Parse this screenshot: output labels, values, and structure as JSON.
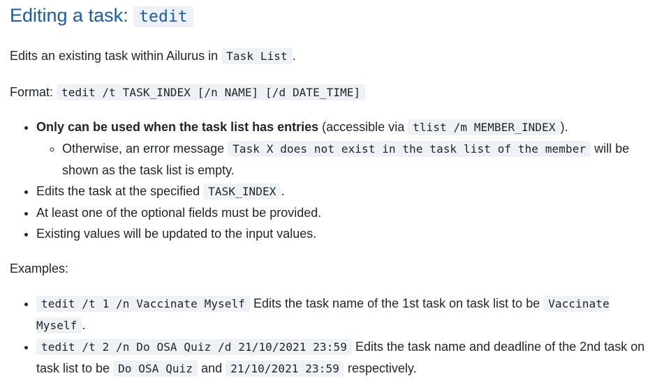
{
  "heading": {
    "text": "Editing a task:",
    "command": "tedit"
  },
  "intro": {
    "before": "Edits an existing task within Ailurus in",
    "code": "Task List",
    "after": "."
  },
  "format": {
    "label": "Format:",
    "code": "tedit /t TASK_INDEX [/n NAME] [/d DATE_TIME]"
  },
  "notes": {
    "item1": {
      "bold": "Only can be used when the task list has entries",
      "before": "(accessible via",
      "code": "tlist /m MEMBER_INDEX",
      "after": ").",
      "sub": {
        "before": "Otherwise, an error message",
        "code": "Task X does not exist in the task list of the member",
        "after": "will be shown as the task list is empty."
      }
    },
    "item2": {
      "before": "Edits the task at the specified",
      "code": "TASK_INDEX",
      "after": "."
    },
    "item3": "At least one of the optional fields must be provided.",
    "item4": "Existing values will be updated to the input values."
  },
  "examples": {
    "label": "Examples:",
    "ex1": {
      "code": "tedit /t 1 /n Vaccinate Myself",
      "text": "Edits the task name of the 1st task on task list to be",
      "code2": "Vaccinate Myself",
      "after": "."
    },
    "ex2": {
      "code": "tedit /t 2 /n Do OSA Quiz /d 21/10/2021 23:59",
      "text": "Edits the task name and deadline of the 2nd task on task list to be",
      "code2": "Do OSA Quiz",
      "mid": "and",
      "code3": "21/10/2021 23:59",
      "after": "respectively."
    }
  },
  "colors": {
    "heading": "#1a5ca8",
    "text": "#212529",
    "code_bg": "#eef2f7"
  }
}
